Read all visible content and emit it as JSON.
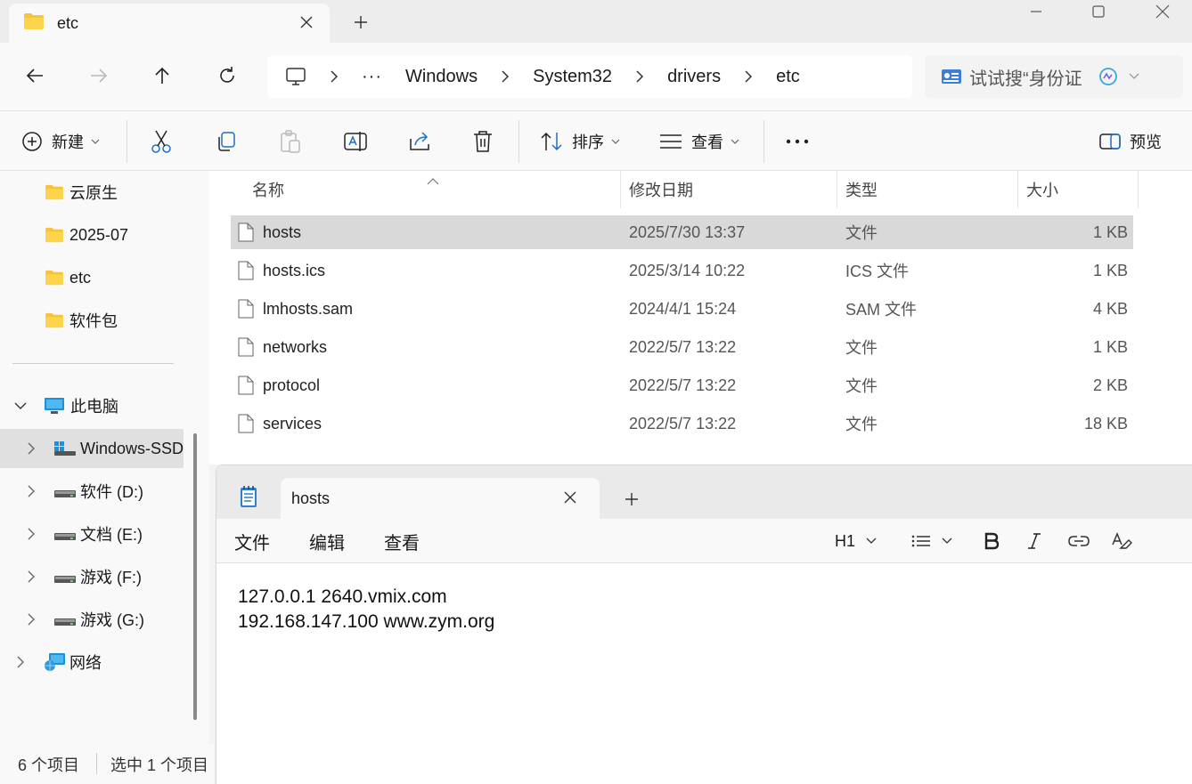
{
  "explorer": {
    "tab_title": "etc",
    "breadcrumb": [
      "Windows",
      "System32",
      "drivers",
      "etc"
    ],
    "breadcrumb_overflow": "···",
    "search_placeholder": "试试搜“身份证",
    "commands": {
      "new_label": "新建",
      "sort_label": "排序",
      "view_label": "查看",
      "more_label": "···",
      "preview_label": "预览"
    },
    "nav": {
      "quick_access": [
        "云原生",
        "2025-07",
        "etc",
        "软件包"
      ],
      "this_pc": "此电脑",
      "drives": [
        "Windows-SSD",
        "软件 (D:)",
        "文档 (E:)",
        "游戏 (F:)",
        "游戏 (G:)"
      ],
      "network": "网络"
    },
    "columns": [
      "名称",
      "修改日期",
      "类型",
      "大小"
    ],
    "files": [
      {
        "name": "hosts",
        "modified": "2025/7/30 13:37",
        "type": "文件",
        "size": "1 KB"
      },
      {
        "name": "hosts.ics",
        "modified": "2025/3/14 10:22",
        "type": "ICS 文件",
        "size": "1 KB"
      },
      {
        "name": "lmhosts.sam",
        "modified": "2024/4/1 15:24",
        "type": "SAM 文件",
        "size": "4 KB"
      },
      {
        "name": "networks",
        "modified": "2022/5/7 13:22",
        "type": "文件",
        "size": "1 KB"
      },
      {
        "name": "protocol",
        "modified": "2022/5/7 13:22",
        "type": "文件",
        "size": "2 KB"
      },
      {
        "name": "services",
        "modified": "2022/5/7 13:22",
        "type": "文件",
        "size": "18 KB"
      }
    ],
    "status": {
      "count": "6 个项目",
      "selected": "选中 1 个项目"
    }
  },
  "notepad": {
    "tab_title": "hosts",
    "menus": [
      "文件",
      "编辑",
      "查看"
    ],
    "heading_select": "H1",
    "content_lines": [
      "127.0.0.1 2640.vmix.com",
      "192.168.147.100 www.zym.org"
    ]
  }
}
